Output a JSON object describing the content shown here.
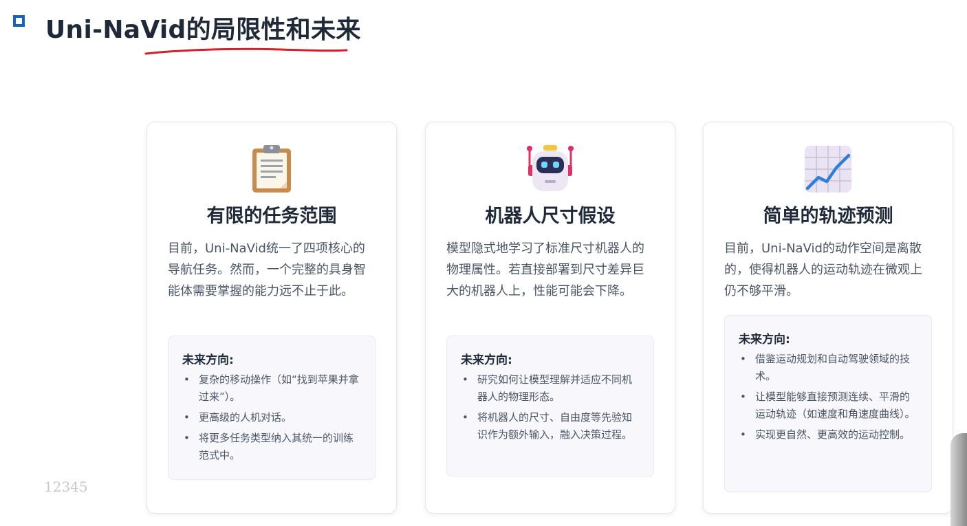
{
  "slide": {
    "title": "Uni-NaVid的局限性和未来",
    "page_number": "12345"
  },
  "cards": [
    {
      "icon": "clipboard-icon",
      "title": "有限的任务范围",
      "description": "目前，Uni-NaVid统一了四项核心的导航任务。然而，一个完整的具身智能体需要掌握的能力远不止于此。",
      "future_heading": "未来方向:",
      "future_items": [
        "复杂的移动操作（如“找到苹果并拿过来”）。",
        "更高级的人机对话。",
        "将更多任务类型纳入其统一的训练范式中。"
      ]
    },
    {
      "icon": "robot-icon",
      "title": "机器人尺寸假设",
      "description": "模型隐式地学习了标准尺寸机器人的物理属性。若直接部署到尺寸差异巨大的机器人上，性能可能会下降。",
      "future_heading": "未来方向:",
      "future_items": [
        "研究如何让模型理解并适应不同机器人的物理形态。",
        "将机器人的尺寸、自由度等先验知识作为额外输入，融入决策过程。"
      ]
    },
    {
      "icon": "chart-increasing-icon",
      "title": "简单的轨迹预测",
      "description": "目前，Uni-NaVid的动作空间是离散的，使得机器人的运动轨迹在微观上仍不够平滑。",
      "future_heading": "未来方向:",
      "future_items": [
        "借鉴运动规划和自动驾驶领域的技术。",
        "让模型能够直接预测连续、平滑的运动轨迹（如速度和角速度曲线）。",
        "实现更自然、更高效的运动控制。"
      ]
    }
  ],
  "colors": {
    "marker": "#1565c0",
    "underline": "#d0202a"
  }
}
